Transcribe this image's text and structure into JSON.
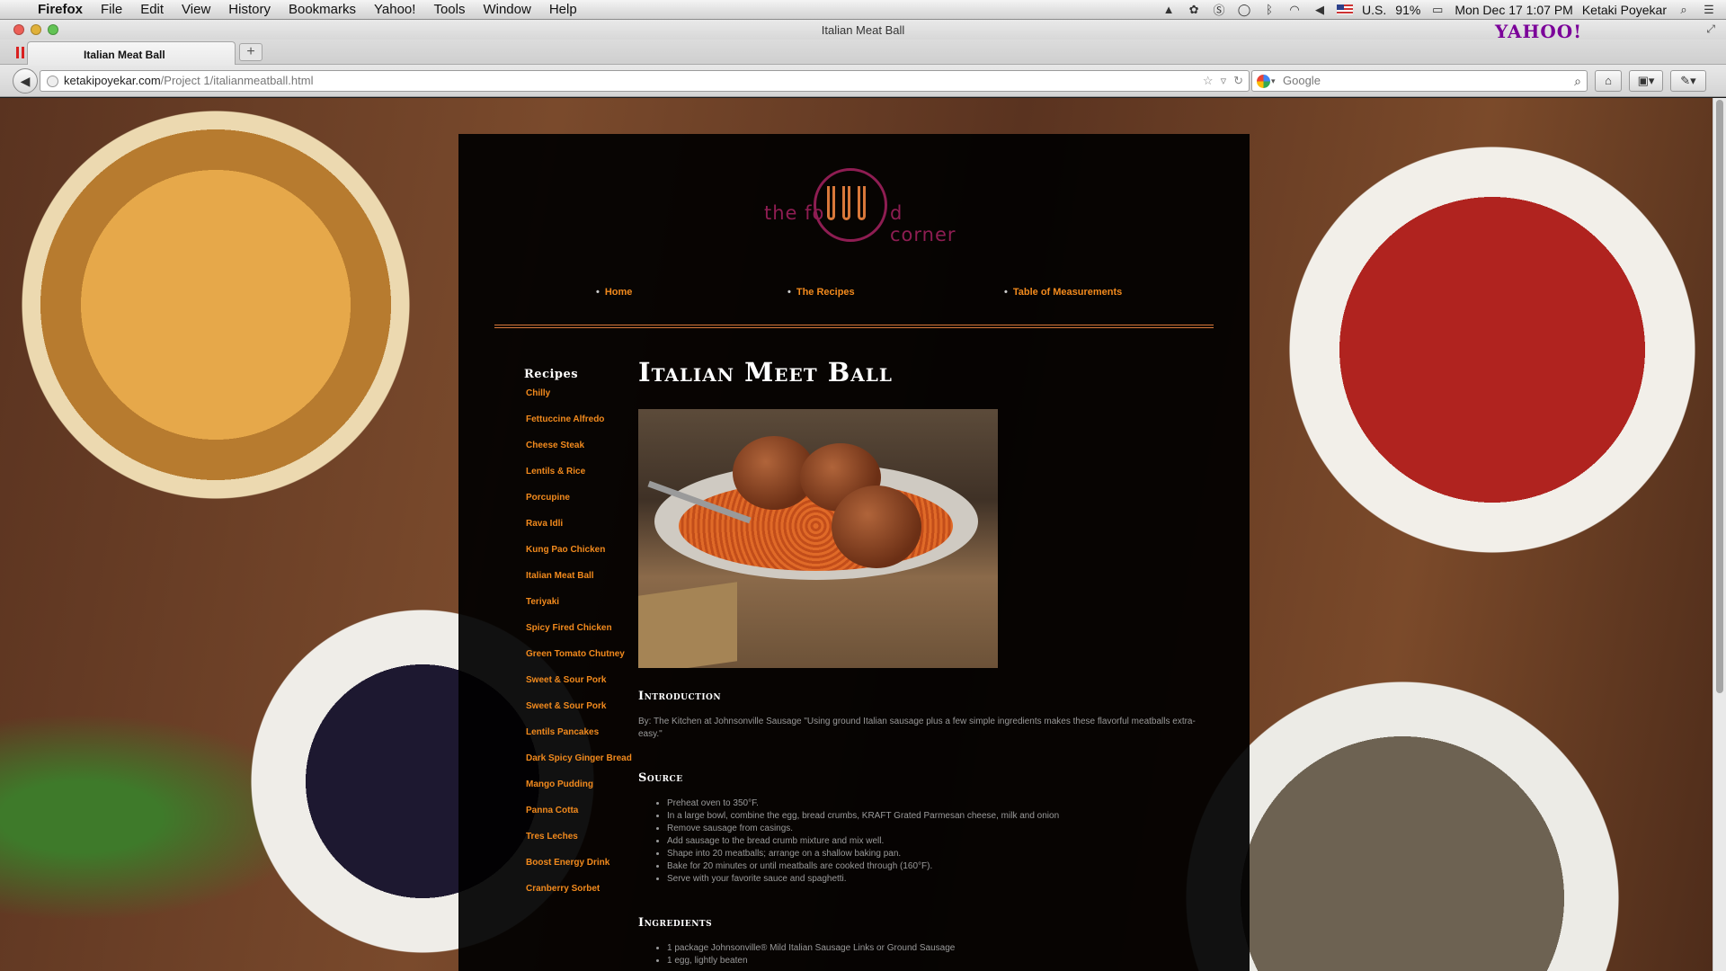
{
  "menubar": {
    "app": "Firefox",
    "items": [
      "File",
      "Edit",
      "View",
      "History",
      "Bookmarks",
      "Yahoo!",
      "Tools",
      "Window",
      "Help"
    ],
    "input_source": "U.S.",
    "battery": "91%",
    "datetime": "Mon Dec 17  1:07 PM",
    "user": "Ketaki Poyekar"
  },
  "window": {
    "title": "Italian Meat Ball",
    "yahoo_logo": "YAHOO!"
  },
  "tabs": [
    {
      "label": "Italian Meat Ball"
    }
  ],
  "newtab_label": "+",
  "address": {
    "domain": "ketakipoyekar.com",
    "path": "/Project 1/italianmeatball.html"
  },
  "search": {
    "placeholder": "Google"
  },
  "site": {
    "logo_text_left": "the fo",
    "logo_text_right": "d corner",
    "nav": [
      "Home",
      "The Recipes",
      "Table of Measurements"
    ],
    "recipes_heading": "Recipes",
    "recipes": [
      "Chilly",
      "Fettuccine Alfredo",
      "Cheese Steak",
      "Lentils & Rice",
      "Porcupine",
      "Rava Idli",
      "Kung Pao Chicken",
      "Italian Meat Ball",
      "Teriyaki",
      "Spicy Fired Chicken",
      "Green Tomato Chutney",
      "Sweet & Sour Pork",
      "Sweet & Sour Pork",
      "Lentils Pancakes",
      "Dark Spicy Ginger Bread",
      "Mango Pudding",
      "Panna Cotta",
      "Tres Leches",
      "Boost Energy Drink",
      "Cranberry Sorbet"
    ],
    "page_title": "Italian Meet Ball",
    "intro_heading": "Introduction",
    "intro_text": "By: The Kitchen at Johnsonville Sausage \"Using ground Italian sausage plus a few simple ingredients makes these flavorful meatballs extra-easy.\"",
    "source_heading": "Source",
    "steps": [
      "Preheat oven to 350°F.",
      "In a large bowl, combine the egg, bread crumbs, KRAFT Grated Parmesan cheese, milk and onion",
      "Remove sausage from casings.",
      "Add sausage to the bread crumb mixture and mix well.",
      "Shape into 20 meatballs; arrange on a shallow baking pan.",
      "Bake for 20 minutes or until meatballs are cooked through (160°F).",
      "Serve with your favorite sauce and spaghetti."
    ],
    "ingredients_heading": "Ingredients",
    "ingredients": [
      "1 package Johnsonville® Mild Italian Sausage Links or Ground Sausage",
      "1 egg, lightly beaten"
    ]
  },
  "colors": {
    "accent": "#f28a1d",
    "logo": "#8e1d52",
    "background": "#000000"
  }
}
